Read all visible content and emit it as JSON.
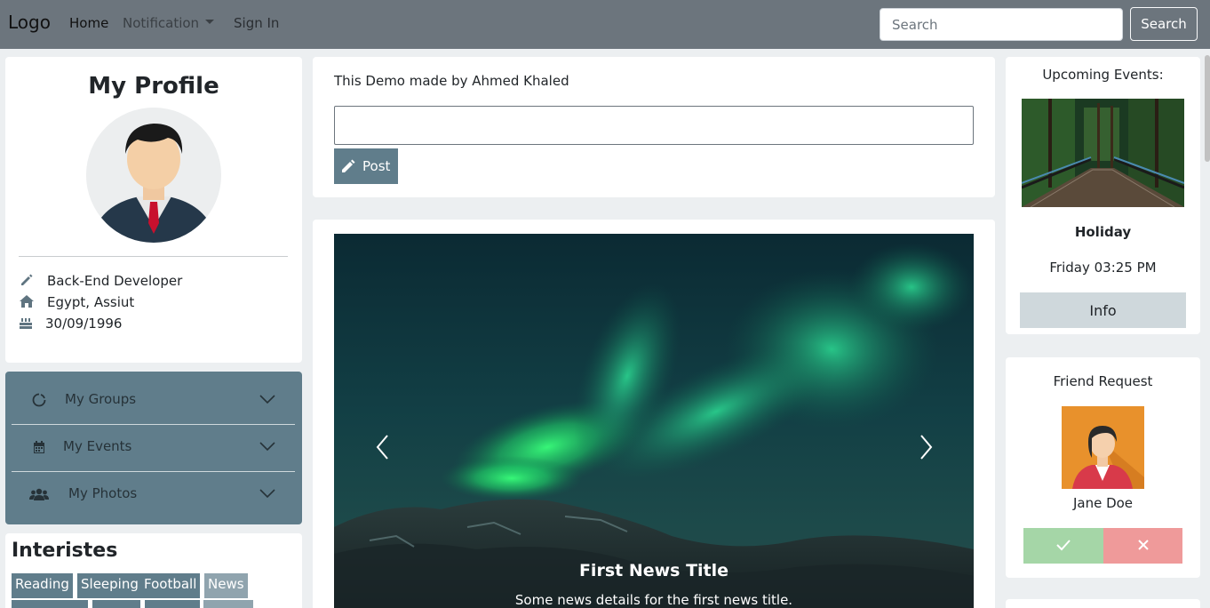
{
  "navbar": {
    "brand": "Logo",
    "home": "Home",
    "notification": "Notification",
    "sign_in": "Sign In",
    "search_placeholder": "Search",
    "search_button": "Search"
  },
  "profile": {
    "title": "My Profile",
    "job": "Back-End Developer",
    "location": "Egypt, Assiut",
    "birthday": "30/09/1996"
  },
  "accordion": {
    "items": [
      {
        "label": "My Groups",
        "icon": "circle-notch-icon"
      },
      {
        "label": "My Events",
        "icon": "calendar-icon"
      },
      {
        "label": "My Photos",
        "icon": "users-icon"
      }
    ]
  },
  "interests": {
    "title": "Interistes",
    "tags": [
      "Reading",
      "Sleeping",
      "Football",
      "News"
    ]
  },
  "poster": {
    "text": "This Demo made by Ahmed Khaled",
    "post_button": "Post"
  },
  "carousel": {
    "title": "First News Title",
    "text": "Some news details for the first news title."
  },
  "events": {
    "title": "Upcoming Events:",
    "name": "Holiday",
    "time": "Friday 03:25 PM",
    "info_button": "Info"
  },
  "friend_request": {
    "title": "Friend Request",
    "name": "Jane Doe"
  },
  "colors": {
    "navbar": "#6c757d",
    "accent": "#607d8b",
    "accept": "#a5d6a7",
    "decline": "#ef9a9a"
  }
}
